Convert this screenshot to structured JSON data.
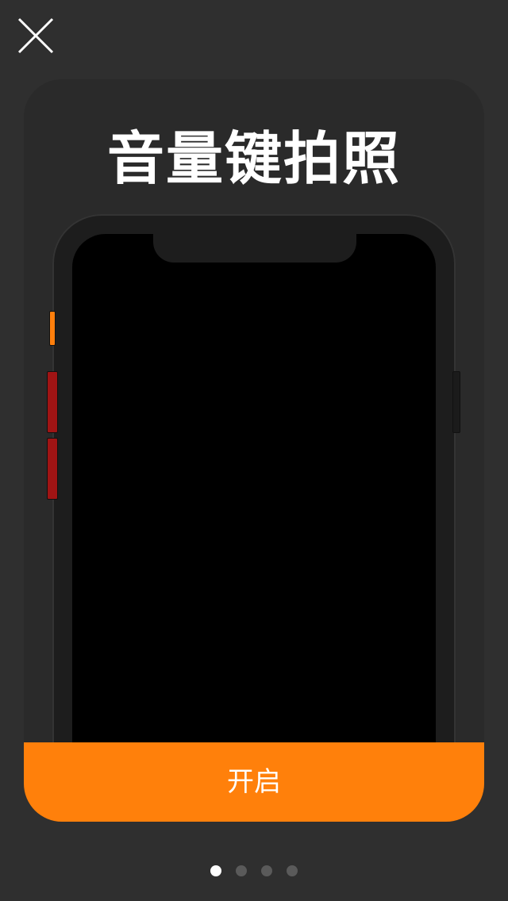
{
  "title": "音量键拍照",
  "buttons": {
    "close_icon": "close-icon",
    "open_label": "开启"
  },
  "pager": {
    "count": 4,
    "active_index": 0
  },
  "colors": {
    "background": "#2f2f2f",
    "accent": "#ff800b",
    "volume_buttons": "#a01414",
    "phone_screen": "#000000",
    "dot_active": "#ffffff",
    "dot_inactive": "#5a5a5a"
  }
}
